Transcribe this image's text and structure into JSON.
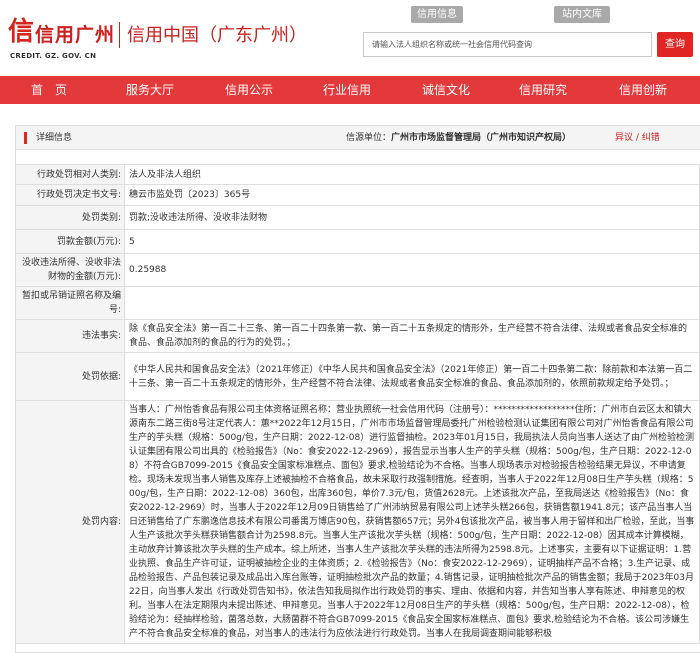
{
  "header": {
    "logo_text": "信用广州",
    "logo_domain": "CREDIT. GZ. GOV. CN",
    "site_name": "信用中国（广东广州）",
    "top_links": [
      "信用信息",
      "站内文库"
    ],
    "search_placeholder": "请输入法人组织名称或统一社会信用代码查询",
    "search_button": "查询"
  },
  "nav": {
    "items": [
      "首　页",
      "服务大厅",
      "信用公示",
      "行业信用",
      "诚信文化",
      "信用研究",
      "信用创新"
    ]
  },
  "detail": {
    "title": "详细信息",
    "source_label": "信源单位：",
    "source_value": "广州市市场监督管理局（广州市知识产权局）",
    "objection": "异议 / 纠错",
    "rows": [
      {
        "label": "行政处罚相对人类别:",
        "value": "法人及非法人组织"
      },
      {
        "label": "行政处罚决定书文号:",
        "value": "穗云市监处罚〔2023〕365号"
      },
      {
        "label": "处罚类别:",
        "value": "罚款;没收违法所得、没收非法财物"
      },
      {
        "label": "罚款金额(万元):",
        "value": "5"
      },
      {
        "label": "没收违法所得、没收非法财物的金额(万元):",
        "value": "0.25988"
      },
      {
        "label": "暂扣或吊销证照名称及编号:",
        "value": ""
      },
      {
        "label": "违法事实:",
        "value": "除《食品安全法》第一百二十三条、第一百二十四条第一款、第一百二十五条规定的情形外，生产经营不符合法律、法规或者食品安全标准的食品、食品添加剂的食品的行为的处罚。；"
      },
      {
        "label": "处罚依据:",
        "value": "《中华人民共和国食品安全法》（2021年修正）《中华人民共和国食品安全法》（2021年修正）第一百二十四条第二款：除前款和本法第一百二十三条、第一百二十五条规定的情形外，生产经营不符合法律、法规或者食品安全标准的食品、食品添加剂的，依照前款规定给予处罚。；"
      },
      {
        "label": "处罚内容:",
        "value": "当事人：广州怡香食品有限公司主体资格证照名称：营业执照统一社会信用代码（注册号）：******************住所：广州市白云区太和镇大源南东二路三街8号注定代表人：蕙**2022年12月15日，广州市市场监督管理局委托广州检验检测认证集团有限公司对广州怡香食品有限公司生产的芋头糕（规格：500g/包，生产日期：2022-12-08）进行监督抽检。2023年01月15日，我局执法人员向当事人送达了由广州检验检测认证集团有限公司出具的《检验报告》（No：食安2022-12-2969），报告显示当事人生产的芋头糕（规格：500g/包，生产日期：2022-12-08）不符合GB7099-2015《食品安全国家标准糕点、面包》要求,检验结论为不合格。当事人现场表示对检验报告检验结果无异议，不申请复检。现场未发现当事人销售及库存上述被抽检不合格食品，故未采取行政强制措施。经查明，当事人于2022年12月08日生产芋头糕（规格：500g/包，生产日期：2022-12-08）360包，出库360包，单价7.3元/包，货值2628元。上述该批次产品，至我局送达《检验报告》（No：食安2022-12-2969）时，当事人于2022年12月09日销售给了广州沛纳贸易有限公司上述芋头糕266包，获销售额1941.8元；该产品当事人当日还销售给了广东鹏逸信息技术有限公司番禺万博店90包，获销售额657元；另外4包该批次产品，被当事人用于留样和出厂检验，至此，当事人生产该批次芋头糕获销售额合计为2598.8元。当事人生产该批次芋头糕（规格：500g/包，生产日期：2022-12-08）因其成本计算模糊，主动放弃计算该批次芋头糕的生产成本。综上所述，当事人生产该批次芋头糕的违法所得为2598.8元。上述事实，主要有以下证据证明：1.营业执照、食品生产许可证，证明被抽检企业的主体资质；2.《检验报告》（No：食安2022-12-2969），证明抽样产品不合格；3.生产记录、成品检验报告、产品包装记录及成品出入库台账等，证明抽检批次产品的数量；4.销售记录，证明抽检批次产品的销售金额；我局于2023年03月22日，向当事人发出《行政处罚告知书》，依法告知我局拟作出行政处罚的事实、理由、依据和内容，并告知当事人享有陈述、申辩意见的权利。当事人在法定期限内未提出陈述、申辩意见。当事人于2022年12月08日生产的芋头糕（规格：500g/包，生产日期：2022-12-08），检验结论为：经抽样检验，菌落总数，大肠菌群不符合GB7099-2015《食品安全国家标准糕点、面包》要求,检验结论为不合格。该公司涉嫌生产不符合食品安全标准的食品，对当事人的违法行为应依法进行行政处罚。当事人在我局调查期间能够积极"
      }
    ]
  }
}
